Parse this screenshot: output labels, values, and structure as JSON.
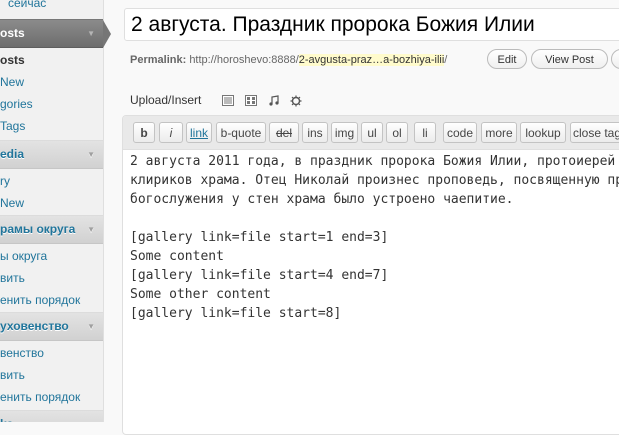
{
  "sidebar": {
    "posts_header": "osts",
    "items": [
      {
        "label": "сейчас",
        "y": 0
      },
      {
        "label": "osts"
      },
      {
        "label": "New"
      },
      {
        "label": "gories"
      },
      {
        "label": "Tags"
      }
    ],
    "media_header": "edia",
    "media_items": [
      "ry",
      "New"
    ],
    "temples_header": "рамы округа",
    "temples_items": [
      "ы округа",
      "вить",
      "енить порядок"
    ],
    "clergy_header": "уховенство",
    "clergy_items": [
      "венство",
      "вить",
      "енить порядок"
    ],
    "bottom_header": "ks",
    "arrow": "▼"
  },
  "post": {
    "title": "2 августа. Праздник пророка Божия Илии",
    "permalink_label": "Permalink:",
    "permalink_base": "http://horoshevo:8888/",
    "permalink_slug": "2-avgusta-praz…a-bozhiya-ilii",
    "permalink_end": "/",
    "edit_button": "Edit",
    "view_button": "View Post"
  },
  "upload": {
    "label": "Upload/Insert",
    "icons": [
      "image-icon",
      "video-icon",
      "audio-icon",
      "media-icon"
    ]
  },
  "quicktags": [
    "b",
    "i",
    "link",
    "b-quote",
    "del",
    "ins",
    "img",
    "ul",
    "ol",
    "li",
    "code",
    "more",
    "lookup",
    "close tags"
  ],
  "content": {
    "lines": [
      "2 августа 2011 года, в праздник пророка Божия Илии, протоиерей",
      "клириков храма. Отец Николай произнес проповедь, посвященную пр",
      "богослужения у стен храма было устроено чаепитие.",
      "",
      "[gallery link=file start=1 end=3]",
      "Some content",
      "[gallery link=file start=4 end=7]",
      "Some other content",
      "[gallery link=file start=8]"
    ]
  }
}
